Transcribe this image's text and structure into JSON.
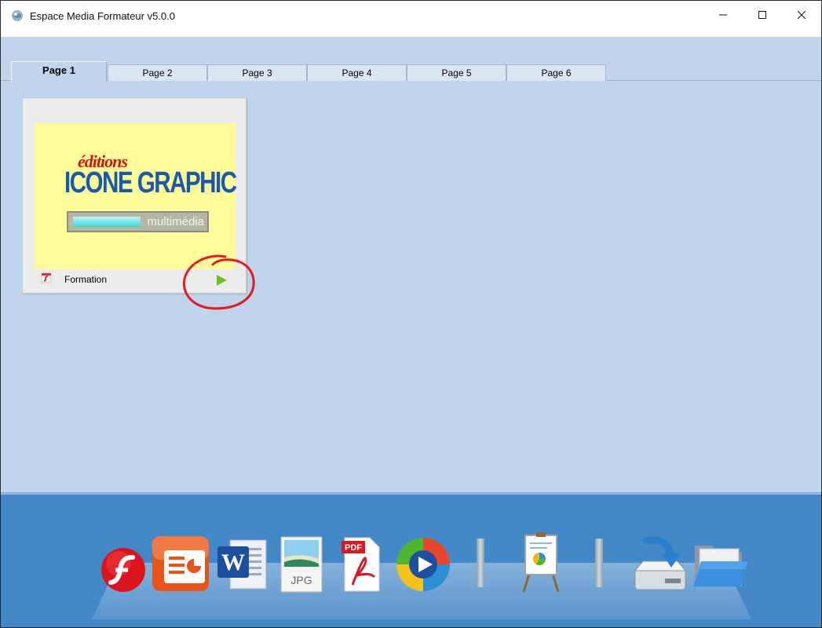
{
  "window": {
    "title": "Espace Media Formateur v5.0.0",
    "controls": {
      "minimize": "—",
      "maximize": "☐",
      "close": "✕"
    }
  },
  "tabs": [
    {
      "label": "Page 1",
      "active": true
    },
    {
      "label": "Page 2",
      "active": false
    },
    {
      "label": "Page 3",
      "active": false
    },
    {
      "label": "Page 4",
      "active": false
    },
    {
      "label": "Page 5",
      "active": false
    },
    {
      "label": "Page 6",
      "active": false
    }
  ],
  "card": {
    "label": "Formation",
    "logo": {
      "line1": "éditions",
      "line2": "ICONE GRAPHIC",
      "bar_text": "multimédia"
    }
  },
  "dock": {
    "items": [
      {
        "icon": "flash-icon"
      },
      {
        "icon": "powerpoint-icon"
      },
      {
        "icon": "word-icon"
      },
      {
        "icon": "jpg-icon",
        "text": "JPG"
      },
      {
        "icon": "pdf-icon",
        "text": "PDF"
      },
      {
        "icon": "media-player-icon"
      },
      {
        "icon": "presentation-board-icon"
      },
      {
        "icon": "install-drive-icon"
      },
      {
        "icon": "folder-icon"
      }
    ]
  },
  "colors": {
    "client_bg": "#c0d4ec",
    "dock_bg": "#4487c6",
    "thumb_bg": "#fffb9a",
    "annotation": "#e11b22",
    "play": "#6cc21c"
  }
}
